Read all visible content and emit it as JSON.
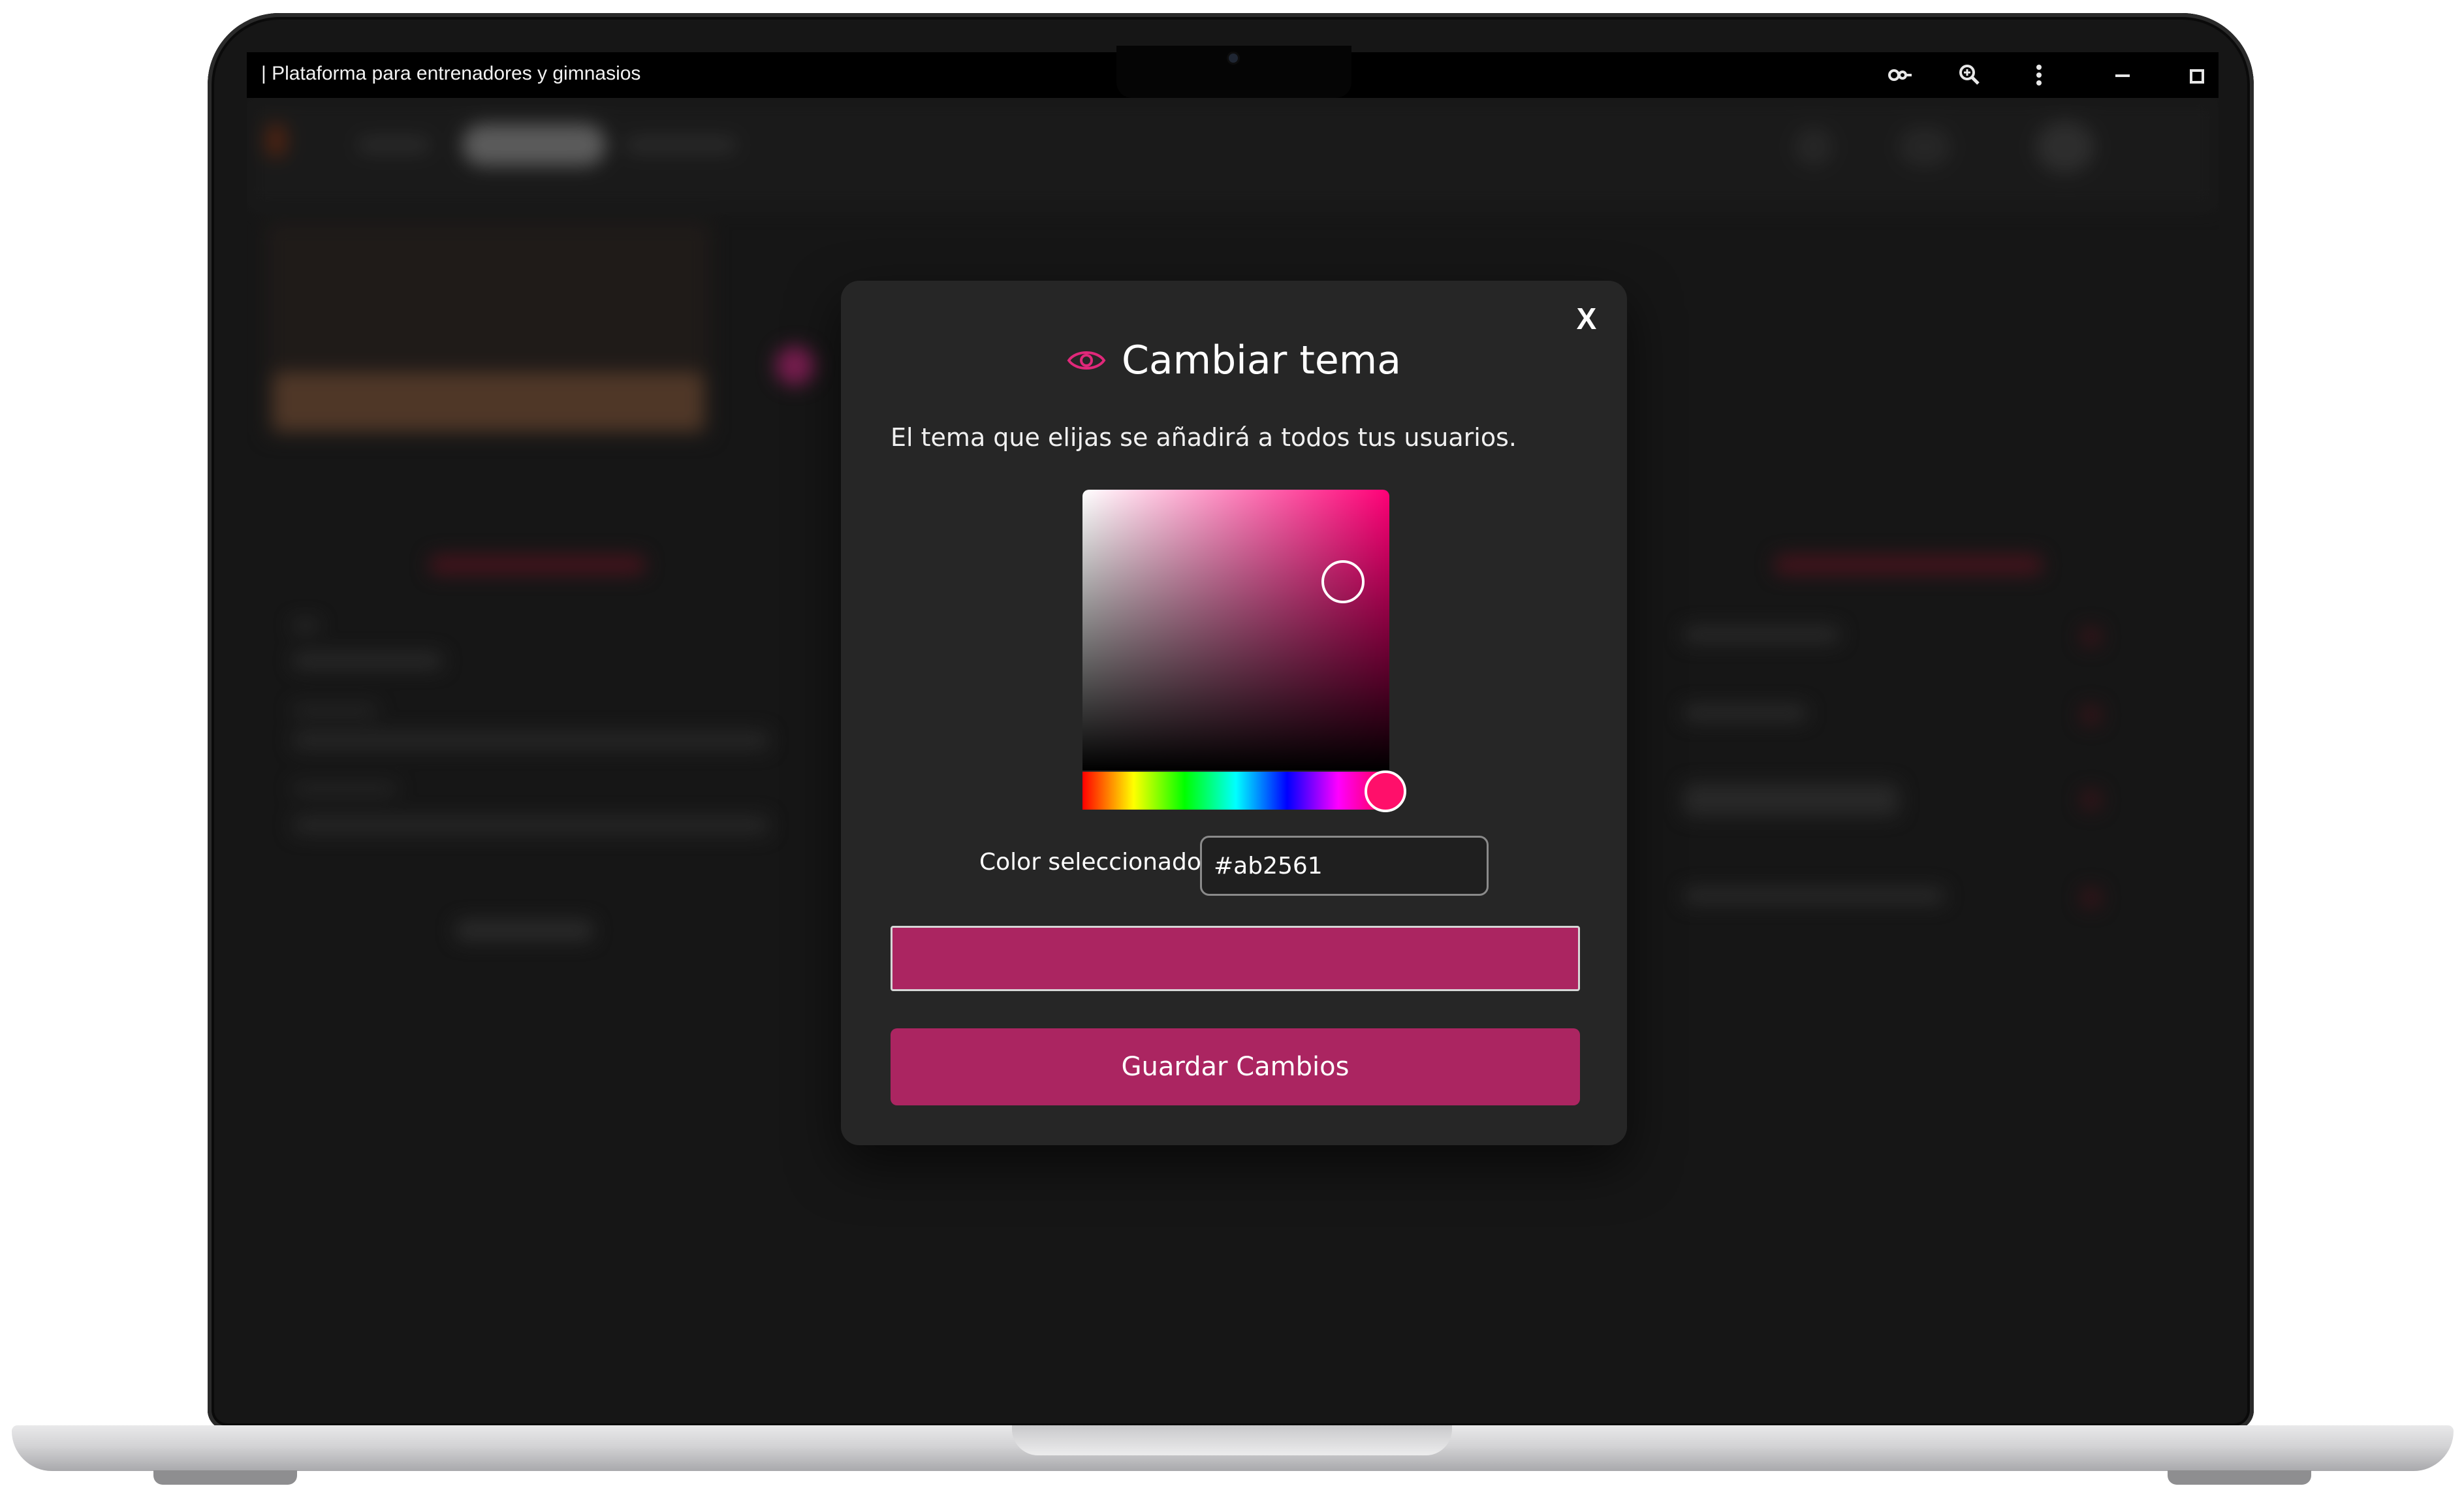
{
  "window": {
    "title": "| Plataforma para entrenadores y gimnasios",
    "icons": [
      "key-icon",
      "zoom-icon",
      "more-vertical-icon",
      "minimize-icon",
      "window-icon"
    ]
  },
  "modal": {
    "close_label": "X",
    "title_icon": "eye-icon",
    "title": "Cambiar tema",
    "description": "El tema que elijas se añadirá a todos tus usuarios.",
    "picker": {
      "selected_label": "Color seleccionado:",
      "hex_value": "#ab2561"
    },
    "save_label": "Guardar Cambios"
  },
  "colors": {
    "accent": "#ab2561",
    "icon_accent": "#e0287a",
    "modal_bg": "#262626",
    "screen_bg": "#1e1e1e"
  }
}
